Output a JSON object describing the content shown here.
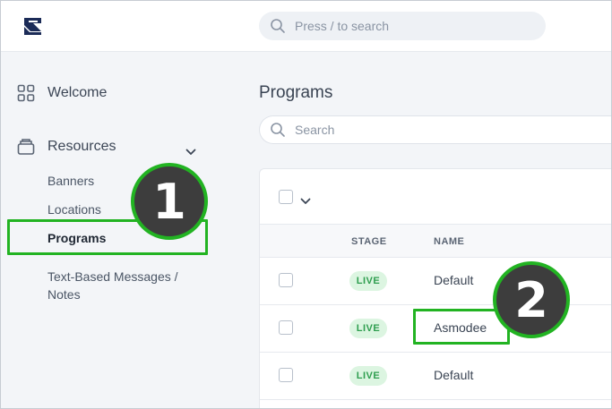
{
  "search": {
    "placeholder": "Press / to search"
  },
  "sidebar": {
    "welcome_label": "Welcome",
    "resources_label": "Resources",
    "sub_items": [
      {
        "label": "Banners"
      },
      {
        "label": "Locations"
      },
      {
        "label": "Programs"
      },
      {
        "label": "Text-Based Messages /"
      },
      {
        "label": "Notes"
      }
    ]
  },
  "main": {
    "title": "Programs",
    "search_placeholder": "Search",
    "columns": {
      "stage": "STAGE",
      "name": "NAME"
    },
    "rows": [
      {
        "stage": "LIVE",
        "name": "Default"
      },
      {
        "stage": "LIVE",
        "name": "Asmodee"
      },
      {
        "stage": "LIVE",
        "name": "Default"
      }
    ]
  },
  "annotations": {
    "step1": "1",
    "step2": "2",
    "color": "#22b322"
  },
  "icons": [
    "logo-icon",
    "search-icon",
    "grid-icon",
    "resources-icon",
    "chevron-down-icon"
  ]
}
